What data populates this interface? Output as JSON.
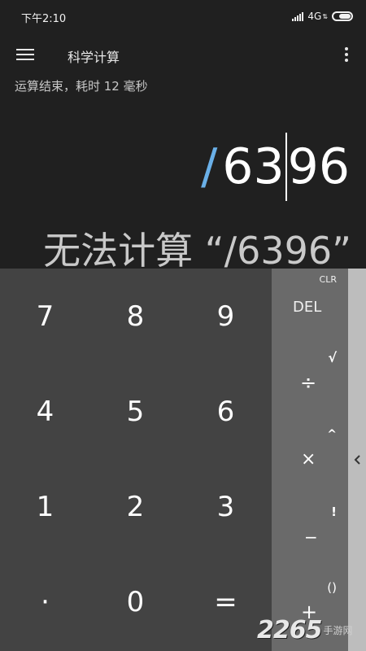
{
  "status_bar": {
    "time": "下午2:10",
    "network": "4G"
  },
  "toolbar": {
    "title": "科学计算",
    "menu_icon": "hamburger-menu-icon",
    "overflow_icon": "more-vertical-icon"
  },
  "timing_message": "运算结束，耗时 12 毫秒",
  "formula": {
    "operator": "/",
    "before_cursor": "63",
    "after_cursor": "96"
  },
  "result": "无法计算 “/6396”",
  "keypad": {
    "rows": [
      [
        "7",
        "8",
        "9"
      ],
      [
        "4",
        "5",
        "6"
      ],
      [
        "1",
        "2",
        "3"
      ],
      [
        "·",
        "0",
        "="
      ]
    ]
  },
  "operators": {
    "clr": "CLR",
    "del": "DEL",
    "sqrt": "√",
    "divide": "÷",
    "power": "^",
    "multiply": "×",
    "factorial": "!",
    "minus": "−",
    "parens": "()",
    "plus": "+"
  },
  "side_panel": {
    "chevron_icon": "chevron-left-icon"
  },
  "watermark": {
    "digits": "2265",
    "text": "手游网"
  },
  "colors": {
    "background": "#202020",
    "numpad": "#434343",
    "operator_panel": "#6a6a6a",
    "side_panel": "#bdbdbd",
    "accent": "#6ab0e8"
  }
}
